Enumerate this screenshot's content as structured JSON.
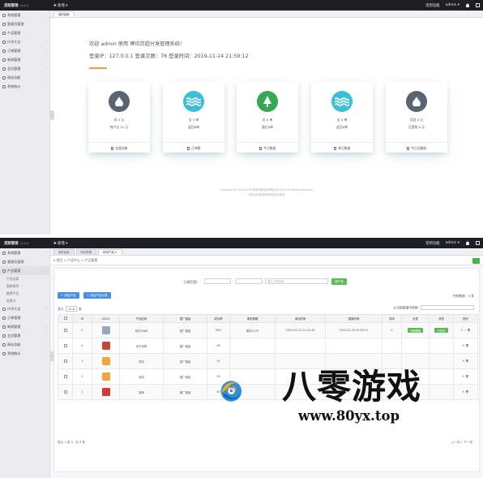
{
  "app": {
    "brand": "贷超管理",
    "version": "v0.0.0",
    "new_menu": "✚ 新增 ▾",
    "user_link": "常用功能",
    "user": "admin ▾"
  },
  "dashboard": {
    "sidebar": [
      {
        "label": "系统管理"
      },
      {
        "label": "管理员管理"
      },
      {
        "label": "产品管理"
      },
      {
        "label": "口子大全"
      },
      {
        "label": "订单管理"
      },
      {
        "label": "新闻管理"
      },
      {
        "label": "会员管理"
      },
      {
        "label": "网站功能"
      },
      {
        "label": "系统统计"
      }
    ],
    "tabs": [
      "我的桌面"
    ],
    "welcome": "欢迎 admin 使用 博讯贷超分发管理系统！",
    "login_info": "登录IP：127.0.0.1  登录次数：76  登录时间：2019-11-24 21:59:12",
    "cards": [
      {
        "icon": "drop-icon",
        "color": "#5a6573",
        "line1": "总 2 元",
        "line2": "待产出 22 元",
        "footer": "充值总额"
      },
      {
        "icon": "wave-icon",
        "color": "#3bc0d8",
        "line1": "全 3 单",
        "line2": "返回0单",
        "footer": "订单数"
      },
      {
        "icon": "tree-icon",
        "color": "#35a853",
        "line1": "总 0 单",
        "line2": "通过0单",
        "footer": "今日数据"
      },
      {
        "icon": "wave-icon",
        "color": "#3bc0d8",
        "line1": "全 0 单",
        "line2": "返回0单",
        "footer": "单日数据"
      },
      {
        "icon": "drop-icon",
        "color": "#5a6573",
        "line1": "话会 0 元",
        "line2": "已提现 0 元",
        "footer": "今日总额度"
      }
    ],
    "copyright": "Copyright @ 2016-2019 博讯科技科技有限公司 v2.0.0 All Rights Reserved",
    "copyright2": "本站点由博讯科技提供技术支持"
  },
  "products": {
    "sidebar": [
      {
        "label": "系统管理"
      },
      {
        "label": "管理员管理"
      },
      {
        "label": "产品管理",
        "open": true
      }
    ],
    "sub_items": [
      "产品分类",
      "网贷系列",
      "推荐产品",
      "信用卡"
    ],
    "sidebar_rest": [
      {
        "label": "口子大全"
      },
      {
        "label": "订单管理"
      },
      {
        "label": "新闻管理"
      },
      {
        "label": "会员管理"
      },
      {
        "label": "网站功能"
      },
      {
        "label": "系统统计"
      }
    ],
    "tabs": [
      "我的桌面",
      "网站配置",
      "网贷产品 ×"
    ],
    "breadcrumb": "⌂ 首页  >  产品中心  >  产品管理",
    "filter_label": "日期范围：",
    "filter_sep": "-",
    "search_placeholder": "输入产品名称",
    "search_button": "搜产品",
    "add_button": "+ 添加产品",
    "add_cat_button": "+ 添加产品分类",
    "total": "共有数据：5 条",
    "show_label": "显示",
    "show_value": "10",
    "show_suffix": "条",
    "search_label": "从当前数据中检索:",
    "columns": [
      "",
      "ID",
      "LOGO",
      "产品名称",
      "推广链接",
      "成功率",
      "审批周期",
      "添加时间",
      "更新时间",
      "排序",
      "分类",
      "状态",
      "操作"
    ],
    "rows": [
      {
        "id": "5",
        "logo": "#9aa7b8",
        "name": "测试3986",
        "link": "推广链接",
        "rate": "90%",
        "cycle": "周末0275",
        "added": "2019-02-22 01:22:34",
        "updated": "2019-02-24 09:03:21",
        "sort": "0",
        "cat": "分期借款",
        "status": "已发布",
        "ops": "✎ ✓ 🗑"
      },
      {
        "id": "4",
        "logo": "#c8453a",
        "name": "闪子加快",
        "link": "推广链接",
        "rate": "98",
        "cycle": "",
        "added": "",
        "updated": "",
        "sort": "",
        "cat": "",
        "status": "",
        "ops": "✎ 🗑"
      },
      {
        "id": "3",
        "logo": "#f2a640",
        "name": "测试",
        "link": "推广链接",
        "rate": "92",
        "cycle": "",
        "added": "",
        "updated": "",
        "sort": "",
        "cat": "",
        "status": "",
        "ops": "✎ 🗑"
      },
      {
        "id": "2",
        "logo": "#f2a640",
        "name": "测试",
        "link": "推广链接",
        "rate": "95",
        "cycle": "",
        "added": "",
        "updated": "",
        "sort": "",
        "cat": "",
        "status": "",
        "ops": "✎ 🗑"
      },
      {
        "id": "1",
        "logo": "#d23a3a",
        "name": "新闻",
        "link": "推广链接",
        "rate": "90",
        "cycle": "",
        "added": "",
        "updated": "",
        "sort": "",
        "cat": "",
        "status": "",
        "ops": "✎ 🗑"
      }
    ],
    "pager_info": "显示 1 到 5，共 5 条",
    "pager": "上一页  1  下一页"
  },
  "watermark": {
    "title": "八零游戏",
    "url": "www.80yx.top"
  }
}
